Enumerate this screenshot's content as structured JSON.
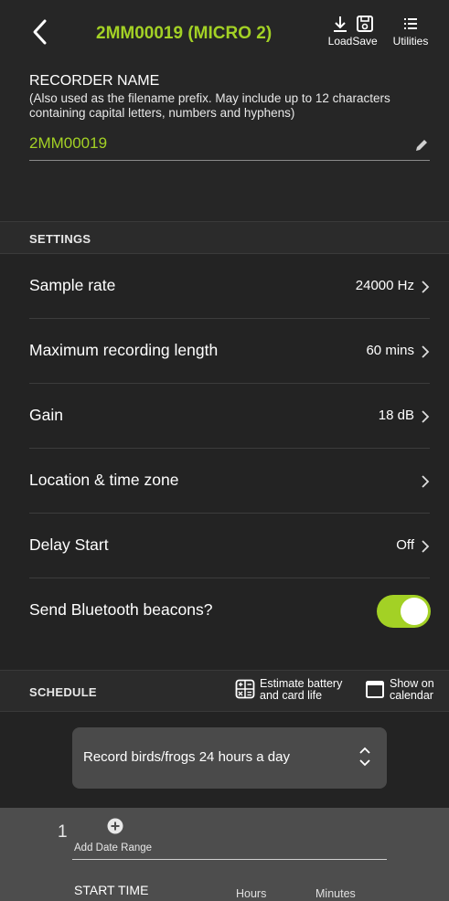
{
  "header": {
    "title": "2MM00019 (MICRO 2)",
    "load_label": "Load",
    "save_label": "Save",
    "utilities_label": "Utilities"
  },
  "recorder": {
    "label": "RECORDER NAME",
    "help": "(Also used as the filename prefix. May include up to 12 characters containing capital letters, numbers and hyphens)",
    "value": "2MM00019"
  },
  "settings": {
    "title": "SETTINGS",
    "rows": [
      {
        "label": "Sample rate",
        "value": "24000 Hz"
      },
      {
        "label": "Maximum recording length",
        "value": "60 mins"
      },
      {
        "label": "Gain",
        "value": "18 dB"
      },
      {
        "label": "Location & time zone",
        "value": ""
      },
      {
        "label": "Delay Start",
        "value": "Off"
      },
      {
        "label": "Send Bluetooth beacons?",
        "toggle_on": true
      }
    ]
  },
  "schedule": {
    "title": "SCHEDULE",
    "estimate_line1": "Estimate battery",
    "estimate_line2": "and card life",
    "calendar_line1": "Show on",
    "calendar_line2": "calendar",
    "selected": "Record birds/frogs 24 hours a day"
  },
  "period": {
    "number": "1",
    "add_date_range": "Add Date Range",
    "start_time": "START TIME",
    "hours": "Hours",
    "minutes": "Minutes"
  },
  "colors": {
    "accent": "#a3d125",
    "background": "#232323"
  }
}
